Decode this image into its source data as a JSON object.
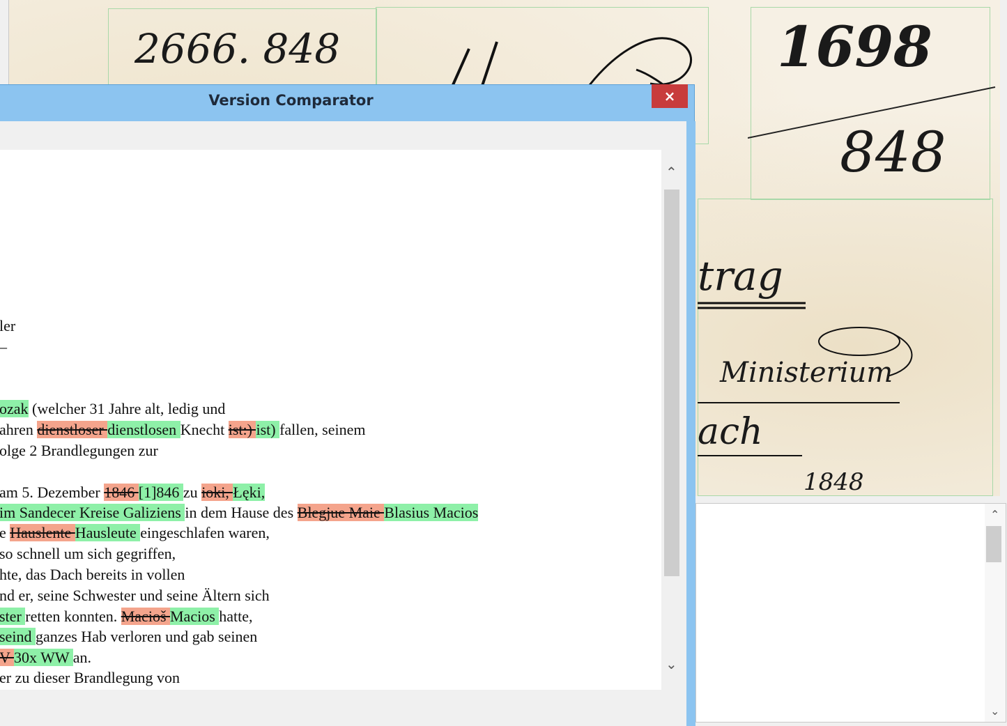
{
  "dialog": {
    "title": "Version Comparator",
    "close_glyph": "×"
  },
  "document": {
    "regions": [
      {
        "text": "2666. 848"
      },
      {
        "text": "1698"
      },
      {
        "text": "848"
      },
      {
        "text": "trag"
      },
      {
        "text": "Ministerium"
      },
      {
        "text": "ach"
      },
      {
        "text": "1848"
      }
    ]
  },
  "comparator": {
    "lines": [
      {
        "segments": [
          {
            "t": "ler",
            "k": "n"
          }
        ]
      },
      {
        "segments": [
          {
            "t": "–",
            "k": "n"
          }
        ]
      },
      {
        "segments": [
          {
            "t": "ozak",
            "k": "ins"
          },
          {
            "t": " (welcher 31 Jahre alt, ledig und",
            "k": "n"
          }
        ]
      },
      {
        "segments": [
          {
            "t": "ahren ",
            "k": "n"
          },
          {
            "t": "dienstloser ",
            "k": "del"
          },
          {
            "t": "dienstlosen ",
            "k": "ins"
          },
          {
            "t": "Knecht ",
            "k": "n"
          },
          {
            "t": "ist:) ",
            "k": "del"
          },
          {
            "t": "ist) ",
            "k": "ins"
          },
          {
            "t": "fallen, seinem",
            "k": "n"
          }
        ]
      },
      {
        "segments": [
          {
            "t": "olge 2 Brandlegungen zur",
            "k": "n"
          }
        ]
      },
      {
        "segments": [
          {
            "t": "am 5. Dezember ",
            "k": "n"
          },
          {
            "t": "1846 ",
            "k": "del"
          },
          {
            "t": "[1]846 ",
            "k": "ins"
          },
          {
            "t": "zu ",
            "k": "n"
          },
          {
            "t": "ioki, ",
            "k": "del"
          },
          {
            "t": "Łęki, ",
            "k": "ins"
          }
        ]
      },
      {
        "segments": [
          {
            "t": "im Sandecer Kreise Galiziens ",
            "k": "ins"
          },
          {
            "t": "in dem Hause des ",
            "k": "n"
          },
          {
            "t": "Blegjue Maie ",
            "k": "del"
          },
          {
            "t": "Blasius Macios ",
            "k": "ins"
          }
        ]
      },
      {
        "segments": [
          {
            "t": "e ",
            "k": "n"
          },
          {
            "t": "Hauslente ",
            "k": "del"
          },
          {
            "t": "Hausleute ",
            "k": "ins"
          },
          {
            "t": "eingeschlafen waren,",
            "k": "n"
          }
        ]
      },
      {
        "segments": [
          {
            "t": "so schnell um sich gegriffen,",
            "k": "n"
          }
        ]
      },
      {
        "segments": [
          {
            "t": "hte, das Dach bereits in vollen",
            "k": "n"
          }
        ]
      },
      {
        "segments": [
          {
            "t": "nd er, seine Schwester und seine Ältern sich",
            "k": "n"
          }
        ]
      },
      {
        "segments": [
          {
            "t": "ster ",
            "k": "ins"
          },
          {
            "t": "retten konnten. ",
            "k": "n"
          },
          {
            "t": "Macioš ",
            "k": "del"
          },
          {
            "t": "Macios ",
            "k": "ins"
          },
          {
            "t": "hatte,",
            "k": "n"
          }
        ]
      },
      {
        "segments": [
          {
            "t": " seind ",
            "k": "ins"
          },
          {
            "t": "ganzes Hab verloren und gab seinen",
            "k": "n"
          }
        ]
      },
      {
        "segments": [
          {
            "t": "V ",
            "k": "del"
          },
          {
            "t": "30x WW ",
            "k": "ins"
          },
          {
            "t": "an.",
            "k": "n"
          }
        ]
      },
      {
        "segments": [
          {
            "t": " er zu dieser Brandlegung von",
            "k": "n"
          }
        ]
      }
    ]
  },
  "icons": {
    "scroll_up": "chevron-up-icon",
    "scroll_down": "chevron-down-icon"
  }
}
